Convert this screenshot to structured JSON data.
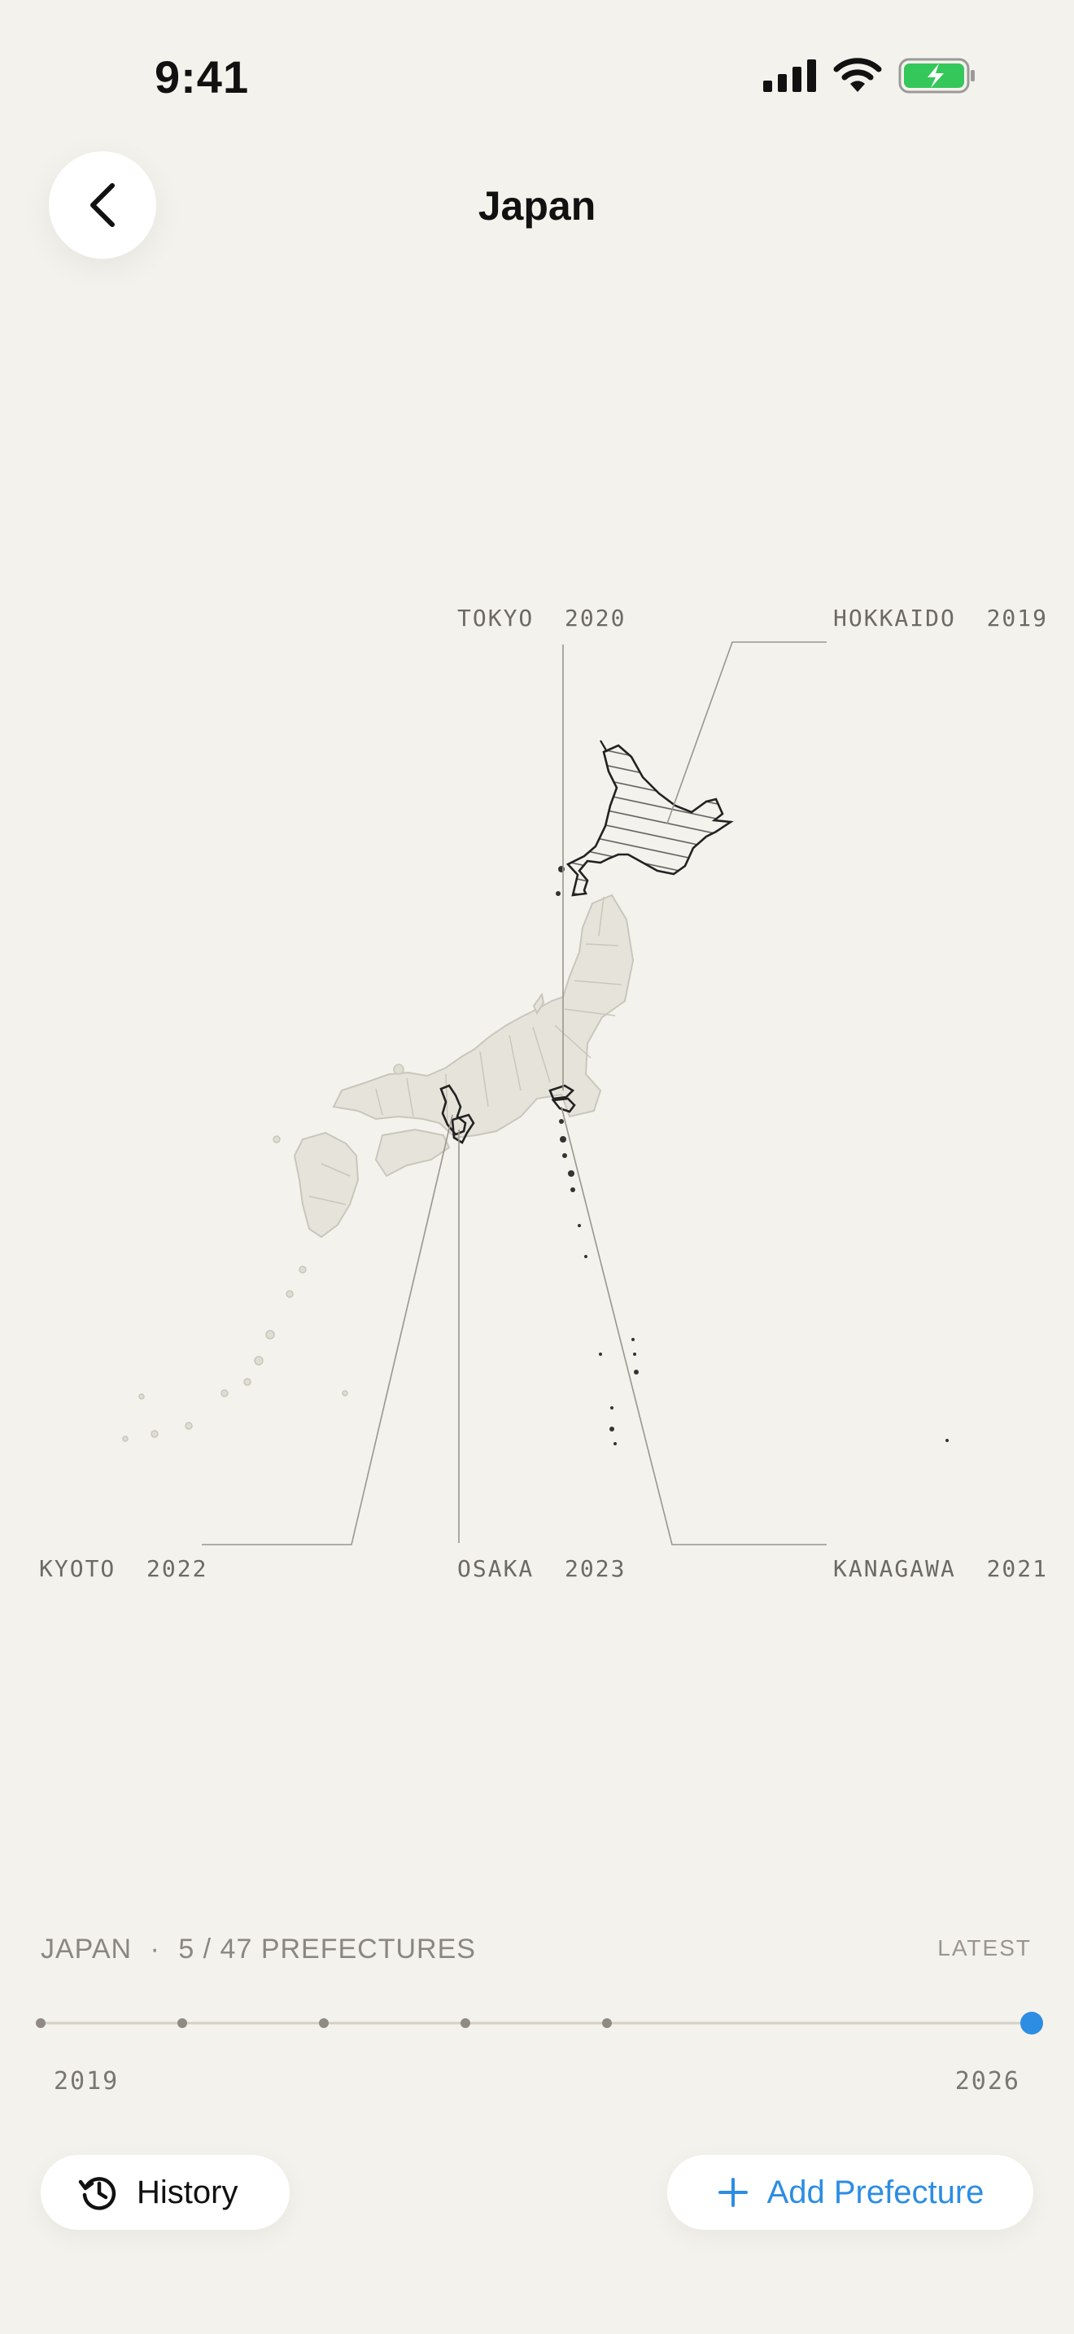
{
  "status": {
    "time": "9:41"
  },
  "nav": {
    "title": "Japan"
  },
  "map_labels": {
    "tokyo": "TOKYO  2020",
    "hokkaido": "HOKKAIDO  2019",
    "kyoto": "KYOTO  2022",
    "osaka": "OSAKA  2023",
    "kanagawa": "KANAGAWA  2021"
  },
  "summary": {
    "country": "JAPAN",
    "separator": "·",
    "count": "5 / 47 PREFECTURES",
    "latest": "LATEST"
  },
  "timeline": {
    "start_year": "2019",
    "end_year": "2026",
    "dots": 6
  },
  "actions": {
    "history_label": "History",
    "add_label": "Add Prefecture"
  },
  "colors": {
    "accent": "#2d8de3",
    "background": "#f4f2ec",
    "land": "#e6e4da",
    "outline": "#2a2a2a"
  }
}
